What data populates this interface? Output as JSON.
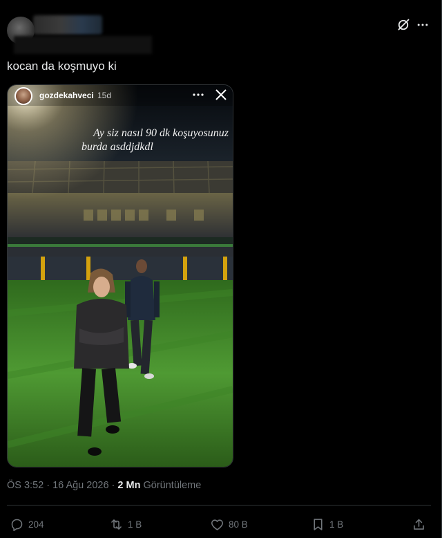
{
  "tweet": {
    "text": "kocan da koşmuyo ki",
    "timestamp": "ÖS 3:52 · 16 Ağu 2026",
    "separator": " · ",
    "views_count": "2 Mn",
    "views_label": "Görüntüleme"
  },
  "story": {
    "username": "gozdekahveci",
    "age": "15d",
    "caption_line1": "Ay siz nasıl 90 dk koşuyosunuz",
    "caption_line2": "burda asddjdkdl"
  },
  "actions": {
    "replies": "204",
    "reposts": "1 B",
    "likes": "80 B",
    "bookmarks": "1 B"
  },
  "icons": {
    "header": [
      "grok-icon",
      "more-icon"
    ],
    "story": [
      "more-dots-icon",
      "close-icon"
    ],
    "actions": [
      "reply-icon",
      "repost-icon",
      "like-icon",
      "bookmark-icon",
      "share-icon"
    ]
  },
  "colors": {
    "background": "#000000",
    "text": "#e7e9ea",
    "muted": "#71767b",
    "border": "#2f3336",
    "pitch": "#4a8a2c"
  }
}
